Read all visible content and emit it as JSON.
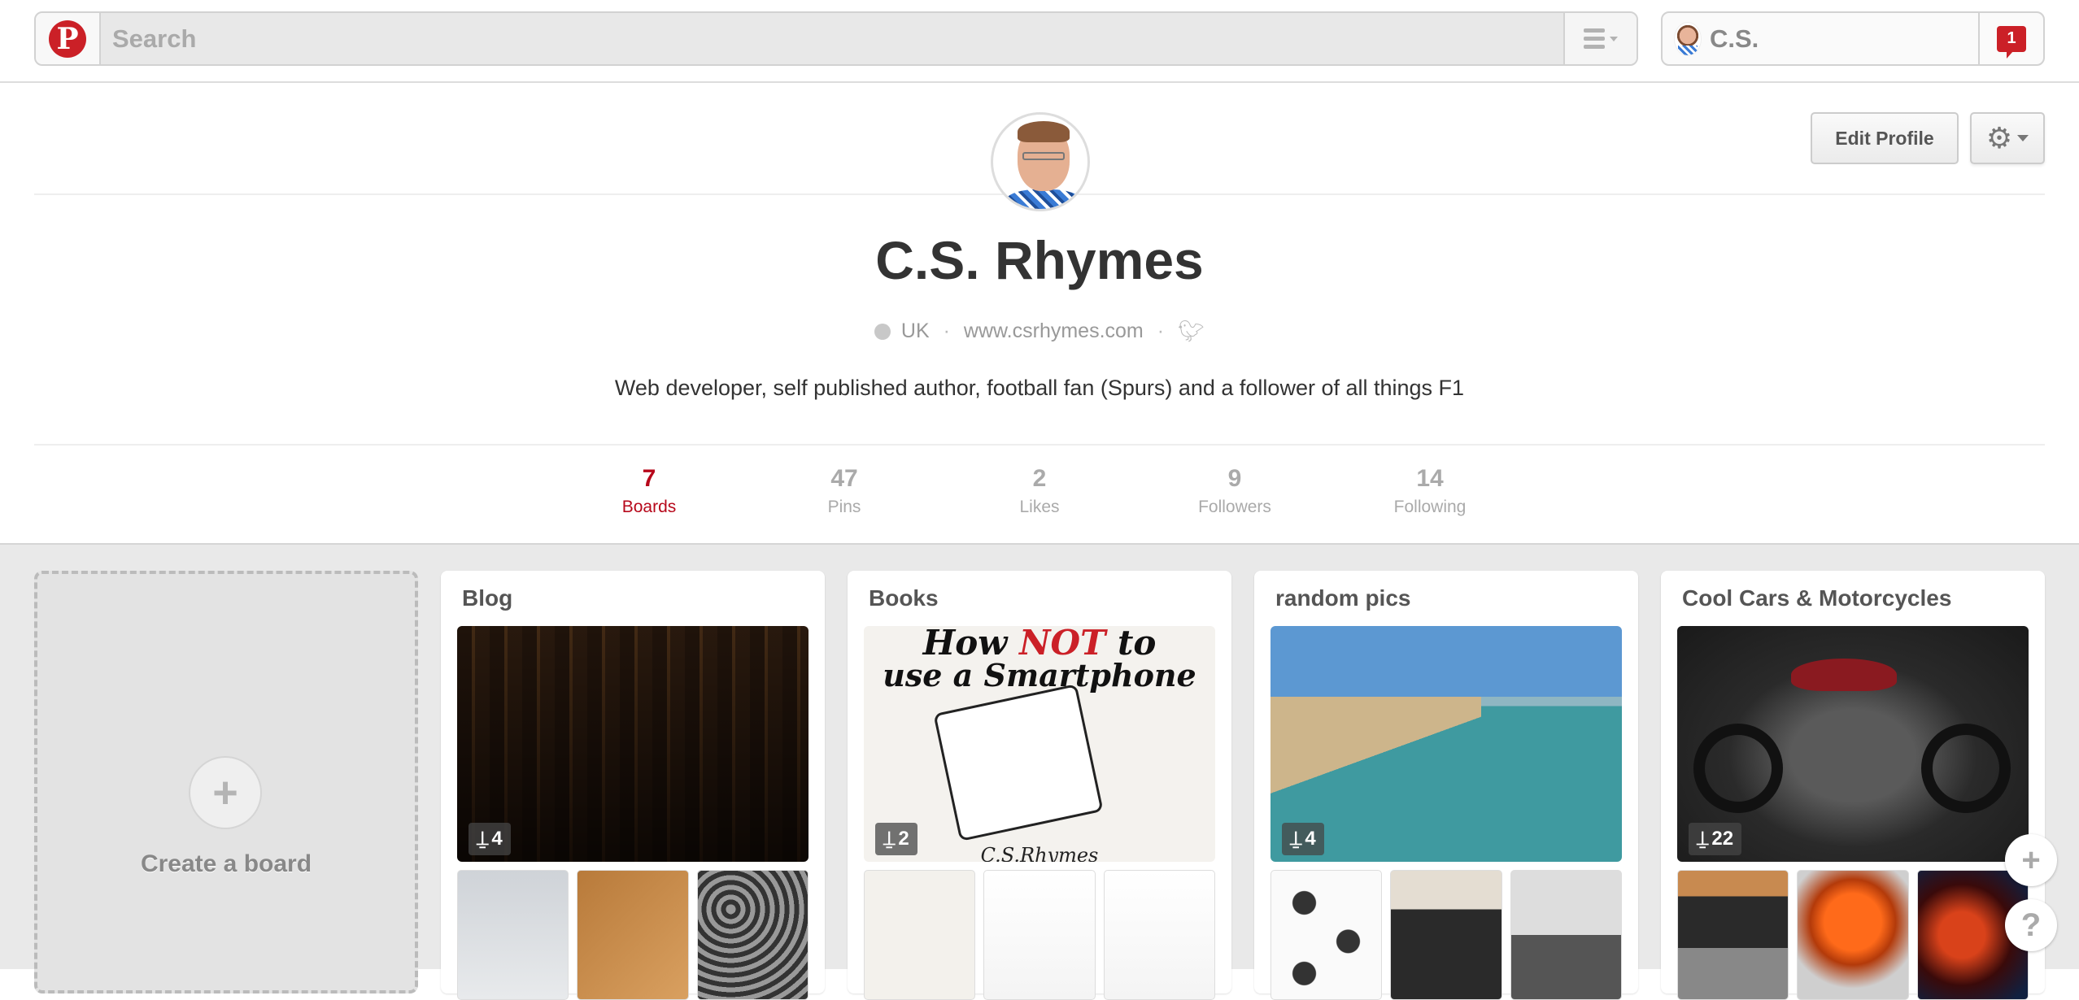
{
  "header": {
    "logo": "P",
    "search_placeholder": "Search",
    "user_name": "C.S.",
    "notification_count": "1"
  },
  "profile": {
    "name": "C.S. Rhymes",
    "location": "UK",
    "website": "www.csrhymes.com",
    "bio": "Web developer, self published author, football fan (Spurs) and a follower of all things F1",
    "edit_label": "Edit Profile",
    "separator": "·"
  },
  "stats": [
    {
      "value": "7",
      "label": "Boards",
      "active": true
    },
    {
      "value": "47",
      "label": "Pins",
      "active": false
    },
    {
      "value": "2",
      "label": "Likes",
      "active": false
    },
    {
      "value": "9",
      "label": "Followers",
      "active": false
    },
    {
      "value": "14",
      "label": "Following",
      "active": false
    }
  ],
  "create_board": {
    "label": "Create a board",
    "icon": "+"
  },
  "boards": [
    {
      "title": "Blog",
      "pin_count": "4"
    },
    {
      "title": "Books",
      "pin_count": "2",
      "cover_line1": "How ",
      "cover_accent": "NOT",
      "cover_line1b": " to",
      "cover_line2": "use a Smartphone",
      "cover_author": "C.S.Rhymes"
    },
    {
      "title": "random pics",
      "pin_count": "4"
    },
    {
      "title": "Cool Cars & Motorcycles",
      "pin_count": "22"
    }
  ],
  "floating": {
    "add": "+",
    "help": "?"
  },
  "colors": {
    "brand_red": "#cb2027",
    "active_stat": "#b7081b"
  }
}
